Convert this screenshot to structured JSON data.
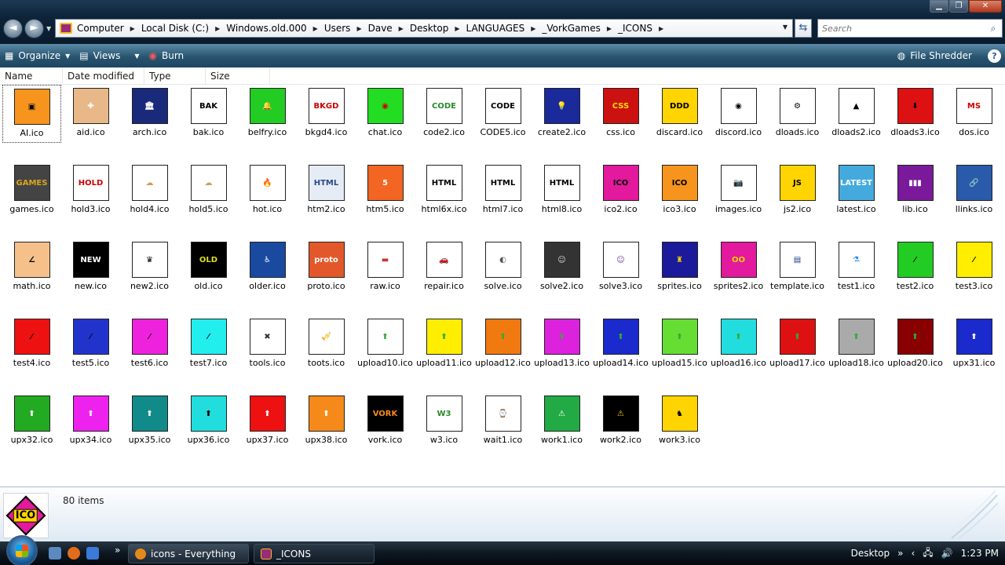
{
  "window": {
    "minimize": "▁",
    "maximize": "❐",
    "close": "✕"
  },
  "nav": {
    "back": "◄",
    "forward": "►"
  },
  "breadcrumbs": [
    "Computer",
    "Local Disk (C:)",
    "Windows.old.000",
    "Users",
    "Dave",
    "Desktop",
    "LANGUAGES",
    "_VorkGames",
    "_ICONS"
  ],
  "search": {
    "placeholder": "Search"
  },
  "toolbar": {
    "organize": "Organize",
    "views": "Views",
    "burn": "Burn",
    "file_shredder": "File Shredder",
    "help": "?"
  },
  "columns": [
    "Name",
    "Date modified",
    "Type",
    "Size"
  ],
  "files": [
    {
      "name": "AI.ico",
      "bg": "#f7941d",
      "fg": "#000",
      "label": "▣"
    },
    {
      "name": "aid.ico",
      "bg": "#e9b888",
      "fg": "#fff",
      "label": "✚"
    },
    {
      "name": "arch.ico",
      "bg": "#1a2a7a",
      "fg": "#fff",
      "label": "🏛"
    },
    {
      "name": "bak.ico",
      "bg": "#ffffff",
      "fg": "#000",
      "label": "BAK"
    },
    {
      "name": "belfry.ico",
      "bg": "#22cc22",
      "fg": "#000",
      "label": "🔔"
    },
    {
      "name": "bkgd4.ico",
      "bg": "#ffffff",
      "fg": "#c00",
      "label": "BKGD"
    },
    {
      "name": "chat.ico",
      "bg": "#22dd22",
      "fg": "#c00",
      "label": "◉"
    },
    {
      "name": "code2.ico",
      "bg": "#ffffff",
      "fg": "#2a8a2a",
      "label": "CODE"
    },
    {
      "name": "CODE5.ico",
      "bg": "#ffffff",
      "fg": "#000",
      "label": "CODE"
    },
    {
      "name": "create2.ico",
      "bg": "#1a2a9a",
      "fg": "#fff",
      "label": "💡"
    },
    {
      "name": "css.ico",
      "bg": "#cc1111",
      "fg": "#ffdd00",
      "label": "CSS"
    },
    {
      "name": "discard.ico",
      "bg": "#ffd400",
      "fg": "#000",
      "label": "DDD"
    },
    {
      "name": "discord.ico",
      "bg": "#ffffff",
      "fg": "#000",
      "label": "◉"
    },
    {
      "name": "dloads.ico",
      "bg": "#ffffff",
      "fg": "#000",
      "label": "⚙"
    },
    {
      "name": "dloads2.ico",
      "bg": "#ffffff",
      "fg": "#000",
      "label": "▲"
    },
    {
      "name": "dloads3.ico",
      "bg": "#dd1111",
      "fg": "#000",
      "label": "⬇"
    },
    {
      "name": "dos.ico",
      "bg": "#ffffff",
      "fg": "#c00",
      "label": "MS"
    },
    {
      "name": "games.ico",
      "bg": "#444444",
      "fg": "#d9a520",
      "label": "GAMES"
    },
    {
      "name": "hold3.ico",
      "bg": "#ffffff",
      "fg": "#c00",
      "label": "HOLD"
    },
    {
      "name": "hold4.ico",
      "bg": "#ffffff",
      "fg": "#c9a35a",
      "label": "☁"
    },
    {
      "name": "hold5.ico",
      "bg": "#ffffff",
      "fg": "#c9a35a",
      "label": "☁"
    },
    {
      "name": "hot.ico",
      "bg": "#ffffff",
      "fg": "#e33",
      "label": "🔥"
    },
    {
      "name": "htm2.ico",
      "bg": "#e6ecf5",
      "fg": "#2a4a8a",
      "label": "HTML"
    },
    {
      "name": "htm5.ico",
      "bg": "#f26522",
      "fg": "#fff",
      "label": "5"
    },
    {
      "name": "html6x.ico",
      "bg": "#ffffff",
      "fg": "#000",
      "label": "HTML"
    },
    {
      "name": "html7.ico",
      "bg": "#ffffff",
      "fg": "#000",
      "label": "HTML"
    },
    {
      "name": "html8.ico",
      "bg": "#ffffff",
      "fg": "#000",
      "label": "HTML"
    },
    {
      "name": "ico2.ico",
      "bg": "#e3199e",
      "fg": "#000",
      "label": "ICO"
    },
    {
      "name": "ico3.ico",
      "bg": "#f7941d",
      "fg": "#000",
      "label": "ICO"
    },
    {
      "name": "images.ico",
      "bg": "#ffffff",
      "fg": "#2a4a8a",
      "label": "📷"
    },
    {
      "name": "js2.ico",
      "bg": "#ffd400",
      "fg": "#000",
      "label": "JS"
    },
    {
      "name": "latest.ico",
      "bg": "#44aadd",
      "fg": "#fff",
      "label": "LATEST"
    },
    {
      "name": "lib.ico",
      "bg": "#7a1a9a",
      "fg": "#fff",
      "label": "▮▮▮"
    },
    {
      "name": "llinks.ico",
      "bg": "#2a5aaa",
      "fg": "#fff",
      "label": "🔗"
    },
    {
      "name": "math.ico",
      "bg": "#f5c08a",
      "fg": "#000",
      "label": "∠"
    },
    {
      "name": "new.ico",
      "bg": "#000000",
      "fg": "#fff",
      "label": "NEW"
    },
    {
      "name": "new2.ico",
      "bg": "#ffffff",
      "fg": "#000",
      "label": "♛"
    },
    {
      "name": "old.ico",
      "bg": "#000000",
      "fg": "#dd2",
      "label": "OLD"
    },
    {
      "name": "older.ico",
      "bg": "#1a4aa0",
      "fg": "#fff",
      "label": "♿"
    },
    {
      "name": "proto.ico",
      "bg": "#e3582a",
      "fg": "#fff",
      "label": "proto"
    },
    {
      "name": "raw.ico",
      "bg": "#ffffff",
      "fg": "#c33",
      "label": "▬"
    },
    {
      "name": "repair.ico",
      "bg": "#ffffff",
      "fg": "#1a5aaa",
      "label": "🚗"
    },
    {
      "name": "solve.ico",
      "bg": "#ffffff",
      "fg": "#555",
      "label": "◐"
    },
    {
      "name": "solve2.ico",
      "bg": "#333333",
      "fg": "#ddd",
      "label": "☺"
    },
    {
      "name": "solve3.ico",
      "bg": "#ffffff",
      "fg": "#6a3a9a",
      "label": "☺"
    },
    {
      "name": "sprites.ico",
      "bg": "#1a1a9a",
      "fg": "#ffd400",
      "label": "♜"
    },
    {
      "name": "sprites2.ico",
      "bg": "#e3199e",
      "fg": "#ffd400",
      "label": "OO"
    },
    {
      "name": "template.ico",
      "bg": "#ffffff",
      "fg": "#1a3a8a",
      "label": "▤"
    },
    {
      "name": "test1.ico",
      "bg": "#ffffff",
      "fg": "#1a8aee",
      "label": "⚗"
    },
    {
      "name": "test2.ico",
      "bg": "#22cc22",
      "fg": "#000",
      "label": "⁄"
    },
    {
      "name": "test3.ico",
      "bg": "#ffee00",
      "fg": "#000",
      "label": "⁄"
    },
    {
      "name": "test4.ico",
      "bg": "#ee1111",
      "fg": "#000",
      "label": "⁄"
    },
    {
      "name": "test5.ico",
      "bg": "#2233cc",
      "fg": "#000",
      "label": "⁄"
    },
    {
      "name": "test6.ico",
      "bg": "#ee22dd",
      "fg": "#000",
      "label": "⁄"
    },
    {
      "name": "test7.ico",
      "bg": "#22eeee",
      "fg": "#000",
      "label": "⁄"
    },
    {
      "name": "tools.ico",
      "bg": "#ffffff",
      "fg": "#333",
      "label": "✖"
    },
    {
      "name": "toots.ico",
      "bg": "#ffffff",
      "fg": "#333",
      "label": "🎺"
    },
    {
      "name": "upload10.ico",
      "bg": "#ffffff",
      "fg": "#3a3",
      "label": "⬆"
    },
    {
      "name": "upload11.ico",
      "bg": "#ffee00",
      "fg": "#3a3",
      "label": "⬆"
    },
    {
      "name": "upload12.ico",
      "bg": "#f07a10",
      "fg": "#3a3",
      "label": "⬆"
    },
    {
      "name": "upload13.ico",
      "bg": "#dd22dd",
      "fg": "#3a3",
      "label": "⬆"
    },
    {
      "name": "upload14.ico",
      "bg": "#1a2acc",
      "fg": "#3a3",
      "label": "⬆"
    },
    {
      "name": "upload15.ico",
      "bg": "#66dd33",
      "fg": "#3a3",
      "label": "⬆"
    },
    {
      "name": "upload16.ico",
      "bg": "#22dddd",
      "fg": "#3a3",
      "label": "⬆"
    },
    {
      "name": "upload17.ico",
      "bg": "#dd1111",
      "fg": "#3a3",
      "label": "⬆"
    },
    {
      "name": "upload18.ico",
      "bg": "#aaaaaa",
      "fg": "#3a3",
      "label": "⬆"
    },
    {
      "name": "upload20.ico",
      "bg": "#880000",
      "fg": "#3a3",
      "label": "⬆"
    },
    {
      "name": "upx31.ico",
      "bg": "#1a2acc",
      "fg": "#fff",
      "label": "⬆"
    },
    {
      "name": "upx32.ico",
      "bg": "#22aa22",
      "fg": "#fff",
      "label": "⬆"
    },
    {
      "name": "upx34.ico",
      "bg": "#ee22ee",
      "fg": "#fff",
      "label": "⬆"
    },
    {
      "name": "upx35.ico",
      "bg": "#118a8a",
      "fg": "#fff",
      "label": "⬆"
    },
    {
      "name": "upx36.ico",
      "bg": "#22dddd",
      "fg": "#000",
      "label": "⬆"
    },
    {
      "name": "upx37.ico",
      "bg": "#ee1111",
      "fg": "#fff",
      "label": "⬆"
    },
    {
      "name": "upx38.ico",
      "bg": "#f58a1a",
      "fg": "#fff",
      "label": "⬆"
    },
    {
      "name": "vork.ico",
      "bg": "#000000",
      "fg": "#f58a1a",
      "label": "VORK"
    },
    {
      "name": "w3.ico",
      "bg": "#ffffff",
      "fg": "#2a8a2a",
      "label": "W3"
    },
    {
      "name": "wait1.ico",
      "bg": "#ffffff",
      "fg": "#000",
      "label": "⌚"
    },
    {
      "name": "work1.ico",
      "bg": "#22aa44",
      "fg": "#fff",
      "label": "⚠"
    },
    {
      "name": "work2.ico",
      "bg": "#000000",
      "fg": "#ffd400",
      "label": "⚠"
    },
    {
      "name": "work3.ico",
      "bg": "#ffd400",
      "fg": "#000",
      "label": "♞"
    }
  ],
  "status": {
    "count": "80 items",
    "preview_label": "ICO"
  },
  "taskbar": {
    "tasks": [
      "icons - Everything",
      "_ICONS"
    ],
    "desktop": "Desktop",
    "chevron": "»",
    "time": "1:23 PM"
  },
  "colors": {
    "accent": "#28546f",
    "ico_pink": "#e3199e",
    "ico_yellow": "#ffd400"
  }
}
